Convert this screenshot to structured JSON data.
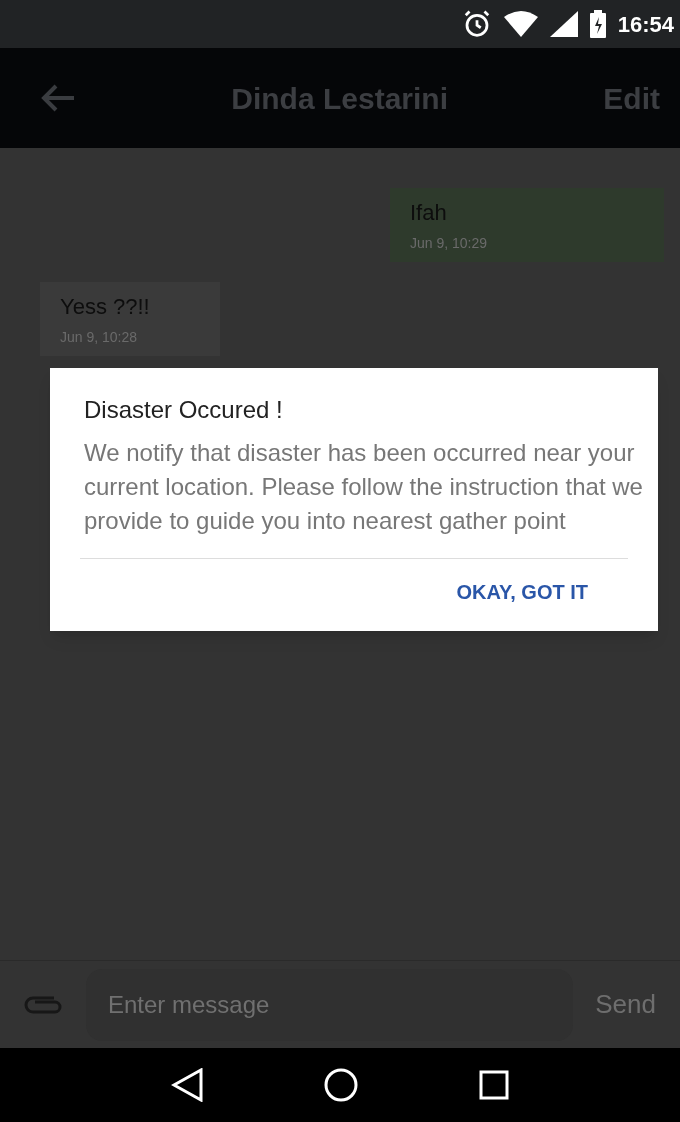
{
  "status_bar": {
    "time": "16:54"
  },
  "toolbar": {
    "title": "Dinda Lestarini",
    "action": "Edit"
  },
  "messages": [
    {
      "text": "Ifah",
      "time": "Jun 9, 10:29",
      "outgoing": true
    },
    {
      "text": "Yess ??!!",
      "time": "Jun 9, 10:28",
      "outgoing": false
    }
  ],
  "dialog": {
    "title": "Disaster Occured !",
    "body": "We notify that disaster has been occurred near your current location. Please follow the instruction that we provide to guide you into nearest gather point",
    "button": "OKAY, GOT IT"
  },
  "composer": {
    "placeholder": "Enter message",
    "send": "Send"
  }
}
